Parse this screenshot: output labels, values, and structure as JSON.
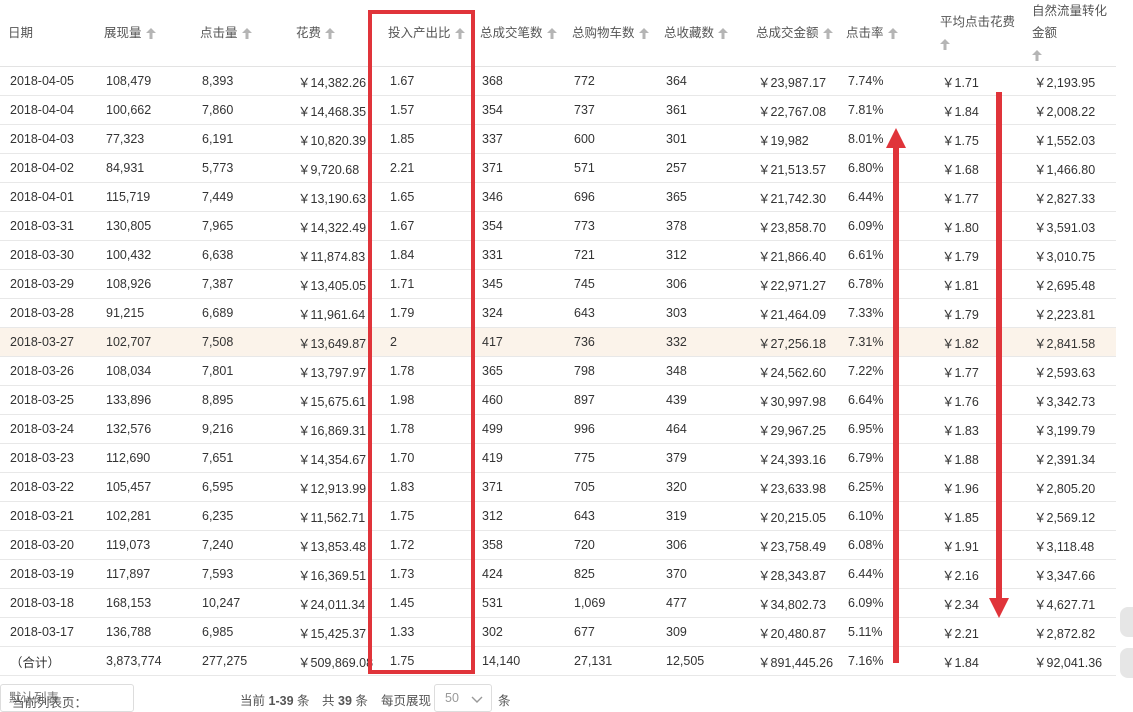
{
  "columns": [
    "日期",
    "展现量",
    "点击量",
    "花费",
    "投入产出比",
    "总成交笔数",
    "总购物车数",
    "总收藏数",
    "总成交金额",
    "点击率",
    "平均点击花费",
    "自然流量转化金额"
  ],
  "rows": [
    [
      "2018-04-05",
      "108,479",
      "8,393",
      "￥14,382.26",
      "1.67",
      "368",
      "772",
      "364",
      "￥23,987.17",
      "7.74%",
      "￥1.71",
      "￥2,193.95"
    ],
    [
      "2018-04-04",
      "100,662",
      "7,860",
      "￥14,468.35",
      "1.57",
      "354",
      "737",
      "361",
      "￥22,767.08",
      "7.81%",
      "￥1.84",
      "￥2,008.22"
    ],
    [
      "2018-04-03",
      "77,323",
      "6,191",
      "￥10,820.39",
      "1.85",
      "337",
      "600",
      "301",
      "￥19,982",
      "8.01%",
      "￥1.75",
      "￥1,552.03"
    ],
    [
      "2018-04-02",
      "84,931",
      "5,773",
      "￥9,720.68",
      "2.21",
      "371",
      "571",
      "257",
      "￥21,513.57",
      "6.80%",
      "￥1.68",
      "￥1,466.80"
    ],
    [
      "2018-04-01",
      "115,719",
      "7,449",
      "￥13,190.63",
      "1.65",
      "346",
      "696",
      "365",
      "￥21,742.30",
      "6.44%",
      "￥1.77",
      "￥2,827.33"
    ],
    [
      "2018-03-31",
      "130,805",
      "7,965",
      "￥14,322.49",
      "1.67",
      "354",
      "773",
      "378",
      "￥23,858.70",
      "6.09%",
      "￥1.80",
      "￥3,591.03"
    ],
    [
      "2018-03-30",
      "100,432",
      "6,638",
      "￥11,874.83",
      "1.84",
      "331",
      "721",
      "312",
      "￥21,866.40",
      "6.61%",
      "￥1.79",
      "￥3,010.75"
    ],
    [
      "2018-03-29",
      "108,926",
      "7,387",
      "￥13,405.05",
      "1.71",
      "345",
      "745",
      "306",
      "￥22,971.27",
      "6.78%",
      "￥1.81",
      "￥2,695.48"
    ],
    [
      "2018-03-28",
      "91,215",
      "6,689",
      "￥11,961.64",
      "1.79",
      "324",
      "643",
      "303",
      "￥21,464.09",
      "7.33%",
      "￥1.79",
      "￥2,223.81"
    ],
    [
      "2018-03-27",
      "102,707",
      "7,508",
      "￥13,649.87",
      "2",
      "417",
      "736",
      "332",
      "￥27,256.18",
      "7.31%",
      "￥1.82",
      "￥2,841.58"
    ],
    [
      "2018-03-26",
      "108,034",
      "7,801",
      "￥13,797.97",
      "1.78",
      "365",
      "798",
      "348",
      "￥24,562.60",
      "7.22%",
      "￥1.77",
      "￥2,593.63"
    ],
    [
      "2018-03-25",
      "133,896",
      "8,895",
      "￥15,675.61",
      "1.98",
      "460",
      "897",
      "439",
      "￥30,997.98",
      "6.64%",
      "￥1.76",
      "￥3,342.73"
    ],
    [
      "2018-03-24",
      "132,576",
      "9,216",
      "￥16,869.31",
      "1.78",
      "499",
      "996",
      "464",
      "￥29,967.25",
      "6.95%",
      "￥1.83",
      "￥3,199.79"
    ],
    [
      "2018-03-23",
      "112,690",
      "7,651",
      "￥14,354.67",
      "1.70",
      "419",
      "775",
      "379",
      "￥24,393.16",
      "6.79%",
      "￥1.88",
      "￥2,391.34"
    ],
    [
      "2018-03-22",
      "105,457",
      "6,595",
      "￥12,913.99",
      "1.83",
      "371",
      "705",
      "320",
      "￥23,633.98",
      "6.25%",
      "￥1.96",
      "￥2,805.20"
    ],
    [
      "2018-03-21",
      "102,281",
      "6,235",
      "￥11,562.71",
      "1.75",
      "312",
      "643",
      "319",
      "￥20,215.05",
      "6.10%",
      "￥1.85",
      "￥2,569.12"
    ],
    [
      "2018-03-20",
      "119,073",
      "7,240",
      "￥13,853.48",
      "1.72",
      "358",
      "720",
      "306",
      "￥23,758.49",
      "6.08%",
      "￥1.91",
      "￥3,118.48"
    ],
    [
      "2018-03-19",
      "117,897",
      "7,593",
      "￥16,369.51",
      "1.73",
      "424",
      "825",
      "370",
      "￥28,343.87",
      "6.44%",
      "￥2.16",
      "￥3,347.66"
    ],
    [
      "2018-03-18",
      "168,153",
      "10,247",
      "￥24,011.34",
      "1.45",
      "531",
      "1,069",
      "477",
      "￥34,802.73",
      "6.09%",
      "￥2.34",
      "￥4,627.71"
    ],
    [
      "2018-03-17",
      "136,788",
      "6,985",
      "￥15,425.37",
      "1.33",
      "302",
      "677",
      "309",
      "￥20,480.87",
      "5.11%",
      "￥2.21",
      "￥2,872.82"
    ]
  ],
  "total_row": [
    "（合计）",
    "3,873,774",
    "277,275",
    "￥509,869.08",
    "1.75",
    "14,140",
    "27,131",
    "12,505",
    "￥891,445.26",
    "7.16%",
    "￥1.84",
    "￥92,041.36"
  ],
  "highlighted_row": 9,
  "highlighted_column": 4,
  "footer": {
    "current_list_label": "当前列表页：",
    "list_placeholder": "默认列表",
    "current_prefix": "当前",
    "current_range": "1-39",
    "current_suffix": "条",
    "total_prefix": "共",
    "total_count": "39",
    "total_suffix": "条",
    "per_page_label": "每页展现",
    "page_size": "50",
    "page_size_suffix": "条"
  },
  "colors": {
    "accent_red": "#e0343a",
    "row_highlight": "#fbf3ea",
    "header_text": "#555555"
  },
  "icons": {
    "sort": "sort-up-arrow-icon",
    "dropdown": "chevron-down-icon"
  }
}
